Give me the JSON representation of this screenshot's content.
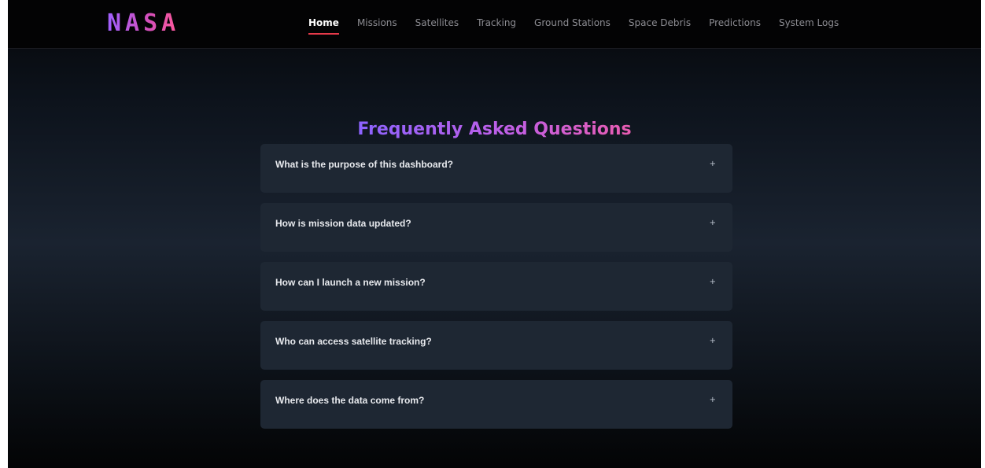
{
  "header": {
    "logo": "NASA",
    "nav": [
      {
        "label": "Home",
        "active": true
      },
      {
        "label": "Missions",
        "active": false
      },
      {
        "label": "Satellites",
        "active": false
      },
      {
        "label": "Tracking",
        "active": false
      },
      {
        "label": "Ground Stations",
        "active": false
      },
      {
        "label": "Space Debris",
        "active": false
      },
      {
        "label": "Predictions",
        "active": false
      },
      {
        "label": "System Logs",
        "active": false
      }
    ]
  },
  "faq": {
    "title": "Frequently Asked Questions",
    "toggle_icon": "+",
    "items": [
      {
        "question": "What is the purpose of this dashboard?"
      },
      {
        "question": "How is mission data updated?"
      },
      {
        "question": "How can I launch a new mission?"
      },
      {
        "question": "Who can access satellite tracking?"
      },
      {
        "question": "Where does the data come from?"
      }
    ]
  },
  "colors": {
    "accent_underline": "#e63a4a",
    "card_bg": "#1e2733",
    "title_gradient_start": "#8c63ff",
    "title_gradient_end": "#e85cb0"
  }
}
